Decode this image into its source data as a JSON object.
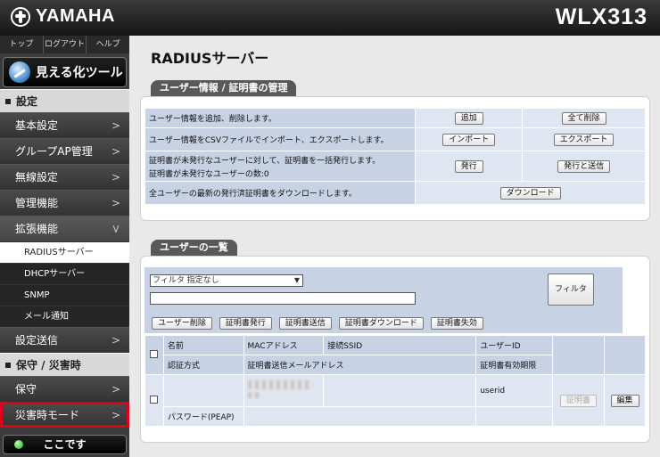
{
  "header": {
    "brand": "YAMAHA",
    "model": "WLX313"
  },
  "sidebar": {
    "top_links": [
      "トップ",
      "ログアウト",
      "ヘルプ"
    ],
    "viz_button": "見える化ツール",
    "section_settings": "設定",
    "items": {
      "basic": "基本設定",
      "group": "グループAP管理",
      "wireless": "無線設定",
      "mgmt": "管理機能",
      "ext": "拡張機能",
      "send": "設定送信",
      "maint": "保守",
      "disaster": "災害時モード"
    },
    "sub_items": [
      "RADIUSサーバー",
      "DHCPサーバー",
      "SNMP",
      "メール通知"
    ],
    "section_maint": "保守 / 災害時",
    "here_button": "ここです",
    "chevron": ">"
  },
  "main": {
    "title": "RADIUSサーバー",
    "panel1": {
      "tab": "ユーザー情報 / 証明書の管理",
      "rows": [
        {
          "text": "ユーザー情報を追加、削除します。",
          "btn1": "追加",
          "btn2": "全て削除"
        },
        {
          "text": "ユーザー情報をCSVファイルでインポート、エクスポートします。",
          "btn1": "インポート",
          "btn2": "エクスポート"
        },
        {
          "text1": "証明書が未発行なユーザーに対して、証明書を一括発行します。",
          "text2": "証明書が未発行なユーザーの数:0",
          "btn1": "発行",
          "btn2": "発行と送信"
        },
        {
          "text": "全ユーザーの最新の発行済証明書をダウンロードします。",
          "btn1": "ダウンロード"
        }
      ]
    },
    "panel2": {
      "tab": "ユーザーの一覧",
      "filter_select": "フィルタ 指定なし",
      "filter_button": "フィルタ",
      "actions": [
        "ユーザー削除",
        "証明書発行",
        "証明書送信",
        "証明書ダウンロード",
        "証明書失効"
      ],
      "headers": {
        "name": "名前",
        "mac": "MACアドレス",
        "ssid": "接続SSID",
        "userid": "ユーザーID",
        "auth": "認証方式",
        "mail": "証明書送信メールアドレス",
        "expiry": "証明書有効期限"
      },
      "row": {
        "userid": "userid",
        "auth": "パスワード(PEAP)",
        "cert_btn": "証明書",
        "edit_btn": "編集"
      }
    }
  }
}
